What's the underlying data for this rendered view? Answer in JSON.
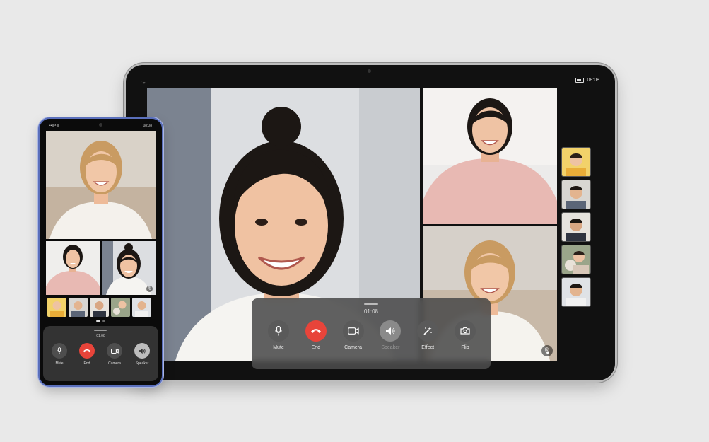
{
  "tablet": {
    "status_right": "08:08",
    "timer": "01:08",
    "controls": [
      {
        "key": "mute",
        "label": "Mute"
      },
      {
        "key": "end",
        "label": "End"
      },
      {
        "key": "camera",
        "label": "Camera"
      },
      {
        "key": "speaker",
        "label": "Speaker"
      },
      {
        "key": "effect",
        "label": "Effect"
      },
      {
        "key": "flip",
        "label": "Flip"
      }
    ]
  },
  "phone": {
    "status_left": "••ıl ᵃ ıl",
    "status_right": "08:08",
    "timer": "01:08",
    "controls": [
      {
        "key": "mute",
        "label": "Mute"
      },
      {
        "key": "end",
        "label": "End"
      },
      {
        "key": "camera",
        "label": "Camera"
      },
      {
        "key": "speaker",
        "label": "Speaker"
      }
    ]
  },
  "colors": {
    "end_call": "#e8443a",
    "phone_frame": "#5a6fbb",
    "background": "#e9e9e9"
  },
  "icons": [
    "microphone-icon",
    "phone-hangup-icon",
    "video-camera-icon",
    "speaker-icon",
    "magic-wand-icon",
    "flip-camera-icon"
  ]
}
